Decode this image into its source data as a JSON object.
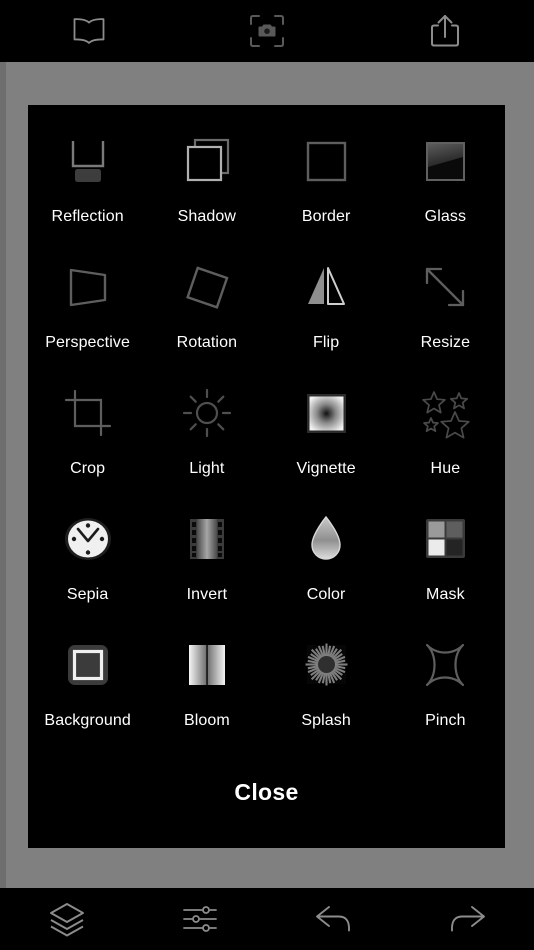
{
  "app": {
    "background_color": "#000000",
    "canvas_color": "#808080",
    "panel_color": "#000000",
    "label_color": "#ffffff",
    "icon_stroke_color": "#8c8c8c"
  },
  "topbar": {
    "items": [
      {
        "name": "book-icon",
        "label": "Book"
      },
      {
        "name": "camera-scan-icon",
        "label": "Camera"
      },
      {
        "name": "share-icon",
        "label": "Share"
      }
    ]
  },
  "panel": {
    "effects": [
      {
        "label": "Reflection",
        "icon": "reflection-icon"
      },
      {
        "label": "Shadow",
        "icon": "shadow-icon"
      },
      {
        "label": "Border",
        "icon": "border-icon"
      },
      {
        "label": "Glass",
        "icon": "glass-icon"
      },
      {
        "label": "Perspective",
        "icon": "perspective-icon"
      },
      {
        "label": "Rotation",
        "icon": "rotation-icon"
      },
      {
        "label": "Flip",
        "icon": "flip-icon"
      },
      {
        "label": "Resize",
        "icon": "resize-icon"
      },
      {
        "label": "Crop",
        "icon": "crop-icon"
      },
      {
        "label": "Light",
        "icon": "light-icon"
      },
      {
        "label": "Vignette",
        "icon": "vignette-icon"
      },
      {
        "label": "Hue",
        "icon": "hue-icon"
      },
      {
        "label": "Sepia",
        "icon": "sepia-icon"
      },
      {
        "label": "Invert",
        "icon": "invert-icon"
      },
      {
        "label": "Color",
        "icon": "color-icon"
      },
      {
        "label": "Mask",
        "icon": "mask-icon"
      },
      {
        "label": "Background",
        "icon": "background-icon"
      },
      {
        "label": "Bloom",
        "icon": "bloom-icon"
      },
      {
        "label": "Splash",
        "icon": "splash-icon"
      },
      {
        "label": "Pinch",
        "icon": "pinch-icon"
      }
    ],
    "close_label": "Close"
  },
  "bottombar": {
    "items": [
      {
        "name": "layers-icon",
        "label": "Layers"
      },
      {
        "name": "adjustments-icon",
        "label": "Adjustments"
      },
      {
        "name": "undo-icon",
        "label": "Undo"
      },
      {
        "name": "redo-icon",
        "label": "Redo"
      }
    ]
  }
}
